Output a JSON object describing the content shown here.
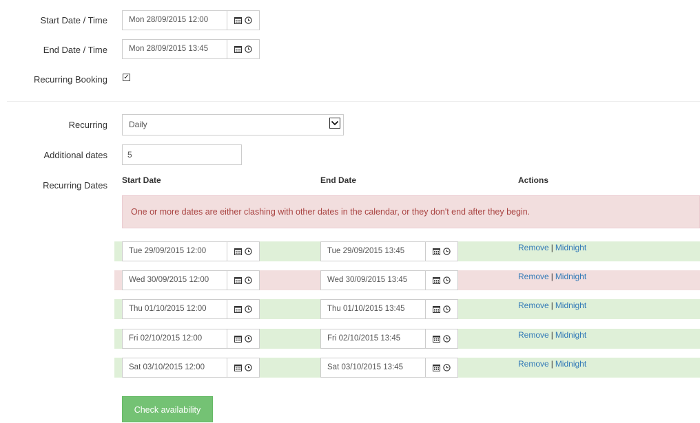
{
  "form": {
    "start_label": "Start Date / Time",
    "start_value": "Mon 28/09/2015 12:00",
    "end_label": "End Date / Time",
    "end_value": "Mon 28/09/2015 13:45",
    "recurring_booking_label": "Recurring Booking",
    "recurring_booking_checked": true,
    "recurring_label": "Recurring",
    "recurring_value": "Daily",
    "additional_label": "Additional dates",
    "additional_value": "5",
    "recurring_dates_label": "Recurring Dates"
  },
  "table": {
    "col_start": "Start Date",
    "col_end": "End Date",
    "col_actions": "Actions",
    "alert": "One or more dates are either clashing with other dates in the calendar, or they don't end after they begin.",
    "rows": [
      {
        "start": "Tue 29/09/2015 12:00",
        "end": "Tue 29/09/2015 13:45",
        "remove": "Remove",
        "midnight": "Midnight",
        "status": "ok"
      },
      {
        "start": "Wed 30/09/2015 12:00",
        "end": "Wed 30/09/2015 13:45",
        "remove": "Remove",
        "midnight": "Midnight",
        "status": "clash"
      },
      {
        "start": "Thu 01/10/2015 12:00",
        "end": "Thu 01/10/2015 13:45",
        "remove": "Remove",
        "midnight": "Midnight",
        "status": "ok"
      },
      {
        "start": "Fri 02/10/2015 12:00",
        "end": "Fri 02/10/2015 13:45",
        "remove": "Remove",
        "midnight": "Midnight",
        "status": "ok"
      },
      {
        "start": "Sat 03/10/2015 12:00",
        "end": "Sat 03/10/2015 13:45",
        "remove": "Remove",
        "midnight": "Midnight",
        "status": "ok"
      }
    ]
  },
  "actions": {
    "check_availability": "Check availability"
  },
  "colors": {
    "ok_row": "#dff0d8",
    "clash_row": "#f2dede",
    "alert_text": "#a94442",
    "link": "#337ab7",
    "button": "#5cb85c"
  }
}
